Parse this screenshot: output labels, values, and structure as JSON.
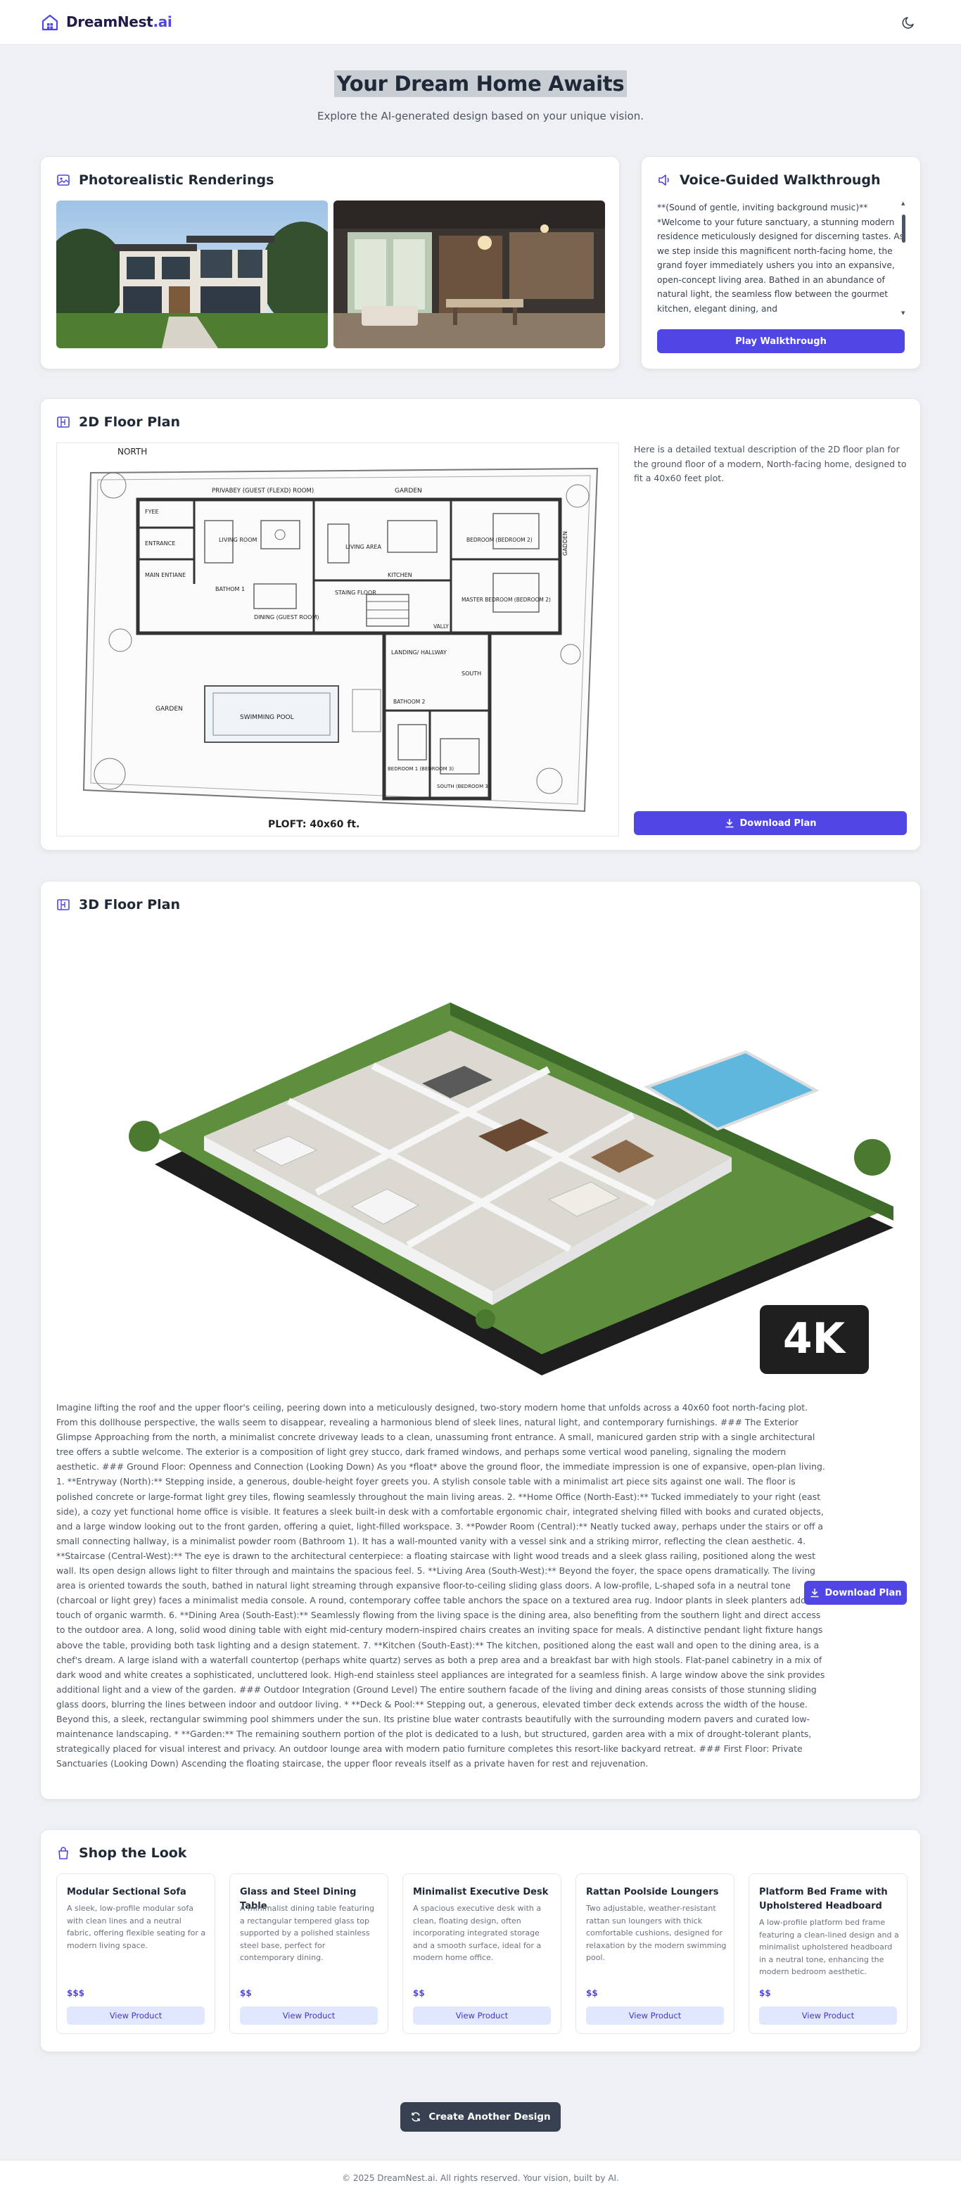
{
  "header": {
    "logo_prefix": "DreamNest",
    "logo_suffix": ".ai",
    "logo_icon": "house-icon",
    "theme_icon": "moon-icon"
  },
  "hero": {
    "title": "Your Dream Home Awaits",
    "subtitle": "Explore the AI-generated design based on your unique vision."
  },
  "renderings": {
    "title": "Photorealistic Renderings",
    "icon": "image-icon"
  },
  "walkthrough": {
    "title": "Voice-Guided Walkthrough",
    "icon": "speaker-icon",
    "text": "**(Sound of gentle, inviting background music)** *Welcome to your future sanctuary, a stunning modern residence meticulously designed for discerning tastes. As we step inside this magnificent north-facing home, the grand foyer immediately ushers you into an expansive, open-concept living area. Bathed in an abundance of natural light, the seamless flow between the gourmet kitchen, elegant dining, and",
    "button": "Play Walkthrough"
  },
  "floor2d": {
    "title": "2D Floor Plan",
    "icon": "blueprint-icon",
    "description": "Here is a detailed textual description of the 2D floor plan for the ground floor of a modern, North-facing home, designed to fit a 40x60 feet plot.",
    "button": "Download Plan",
    "plan_labels": {
      "north": "NORTH",
      "plot": "PLOFT: 40x60 ft.",
      "privacy": "PRIVABEY (GUEST (FLEXD) ROOM)",
      "garden_top": "GARDEN",
      "foyer": "FYEE",
      "entrance": "ENTRANCE",
      "main_entrance": "MAIN ENTIANE",
      "living_room": "LIVING ROOM",
      "living_area": "LIVING AREA",
      "bathroom1": "BATHOM 1",
      "dining": "DINING (GUEST ROOM)",
      "kitchen": "KITCHEN",
      "staircase": "STAING FLOOR",
      "bedroom2": "BEDROOM (BEDROOM 2)",
      "master": "MASTER BEDROOM (BEDROOM 2)",
      "garden_right": "GADDEN",
      "vally": "VALLY",
      "landing": "LANDING/ HALLWAY",
      "south": "SOUTH",
      "garden_left": "GARDEN",
      "pool": "SWIMMING POOL",
      "bathroom2": "BATHOOM 2",
      "bedroom1": "BEDROOM 1 (BEDROOM 3)",
      "south_bedroom": "SOUTH (BEDROOM 3)"
    }
  },
  "floor3d": {
    "title": "3D Floor Plan",
    "icon": "blueprint-icon",
    "badge": "4K",
    "button": "Download Plan",
    "description": "Imagine lifting the roof and the upper floor's ceiling, peering down into a meticulously designed, two-story modern home that unfolds across a 40x60 foot north-facing plot. From this dollhouse perspective, the walls seem to disappear, revealing a harmonious blend of sleek lines, natural light, and contemporary furnishings. ### The Exterior Glimpse Approaching from the north, a minimalist concrete driveway leads to a clean, unassuming front entrance. A small, manicured garden strip with a single architectural tree offers a subtle welcome. The exterior is a composition of light grey stucco, dark framed windows, and perhaps some vertical wood paneling, signaling the modern aesthetic. ### Ground Floor: Openness and Connection (Looking Down) As you *float* above the ground floor, the immediate impression is one of expansive, open-plan living. 1. **Entryway (North):** Stepping inside, a generous, double-height foyer greets you. A stylish console table with a minimalist art piece sits against one wall. The floor is polished concrete or large-format light grey tiles, flowing seamlessly throughout the main living areas. 2. **Home Office (North-East):** Tucked immediately to your right (east side), a cozy yet functional home office is visible. It features a sleek built-in desk with a comfortable ergonomic chair, integrated shelving filled with books and curated objects, and a large window looking out to the front garden, offering a quiet, light-filled workspace. 3. **Powder Room (Central):** Neatly tucked away, perhaps under the stairs or off a small connecting hallway, is a minimalist powder room (Bathroom 1). It has a wall-mounted vanity with a vessel sink and a striking mirror, reflecting the clean aesthetic. 4. **Staircase (Central-West):** The eye is drawn to the architectural centerpiece: a floating staircase with light wood treads and a sleek glass railing, positioned along the west wall. Its open design allows light to filter through and maintains the spacious feel. 5. **Living Area (South-West):** Beyond the foyer, the space opens dramatically. The living area is oriented towards the south, bathed in natural light streaming through expansive floor-to-ceiling sliding glass doors. A low-profile, L-shaped sofa in a neutral tone (charcoal or light grey) faces a minimalist media console. A round, contemporary coffee table anchors the space on a textured area rug. Indoor plants in sleek planters add a touch of organic warmth. 6. **Dining Area (South-East):** Seamlessly flowing from the living space is the dining area, also benefiting from the southern light and direct access to the outdoor area. A long, solid wood dining table with eight mid-century modern-inspired chairs creates an inviting space for meals. A distinctive pendant light fixture hangs above the table, providing both task lighting and a design statement. 7. **Kitchen (South-East):** The kitchen, positioned along the east wall and open to the dining area, is a chef's dream. A large island with a waterfall countertop (perhaps white quartz) serves as both a prep area and a breakfast bar with high stools. Flat-panel cabinetry in a mix of dark wood and white creates a sophisticated, uncluttered look. High-end stainless steel appliances are integrated for a seamless finish. A large window above the sink provides additional light and a view of the garden. ### Outdoor Integration (Ground Level) The entire southern facade of the living and dining areas consists of those stunning sliding glass doors, blurring the lines between indoor and outdoor living. * **Deck & Pool:** Stepping out, a generous, elevated timber deck extends across the width of the house. Beyond this, a sleek, rectangular swimming pool shimmers under the sun. Its pristine blue water contrasts beautifully with the surrounding modern pavers and curated low-maintenance landscaping. * **Garden:** The remaining southern portion of the plot is dedicated to a lush, but structured, garden area with a mix of drought-tolerant plants, strategically placed for visual interest and privacy. An outdoor lounge area with modern patio furniture completes this resort-like backyard retreat. ### First Floor: Private Sanctuaries (Looking Down) Ascending the floating staircase, the upper floor reveals itself as a private haven for rest and rejuvenation."
  },
  "shop": {
    "title": "Shop the Look",
    "icon": "shopping-bag-icon",
    "products": [
      {
        "name": "Modular Sectional Sofa",
        "desc": "A sleek, low-profile modular sofa with clean lines and a neutral fabric, offering flexible seating for a modern living space.",
        "price": "$$$",
        "button": "View Product"
      },
      {
        "name": "Glass and Steel Dining Table",
        "desc": "A minimalist dining table featuring a rectangular tempered glass top supported by a polished stainless steel base, perfect for contemporary dining.",
        "price": "$$",
        "button": "View Product"
      },
      {
        "name": "Minimalist Executive Desk",
        "desc": "A spacious executive desk with a clean, floating design, often incorporating integrated storage and a smooth surface, ideal for a modern home office.",
        "price": "$$",
        "button": "View Product"
      },
      {
        "name": "Rattan Poolside Loungers",
        "desc": "Two adjustable, weather-resistant rattan sun loungers with thick comfortable cushions, designed for relaxation by the modern swimming pool.",
        "price": "$$",
        "button": "View Product"
      },
      {
        "name": "Platform Bed Frame with Upholstered Headboard",
        "desc": "A low-profile platform bed frame featuring a clean-lined design and a minimalist upholstered headboard in a neutral tone, enhancing the modern bedroom aesthetic.",
        "price": "$$",
        "button": "View Product"
      }
    ]
  },
  "cta": {
    "label": "Create Another Design",
    "icon": "refresh-icon"
  },
  "footer": {
    "text": "© 2025 DreamNest.ai. All rights reserved. Your vision, built by AI."
  },
  "colors": {
    "accent": "#4f46e5",
    "dark": "#374151",
    "background": "#eef0f3"
  }
}
